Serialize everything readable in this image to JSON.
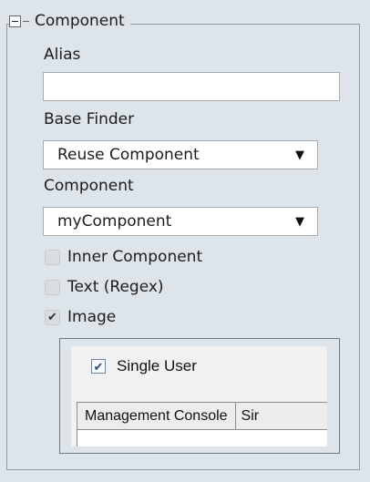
{
  "section": {
    "title": "Component"
  },
  "alias": {
    "label": "Alias",
    "value": ""
  },
  "base_finder": {
    "label": "Base Finder",
    "selected": "Reuse Component",
    "arrow": "▼"
  },
  "component": {
    "label": "Component",
    "selected": "myComponent",
    "arrow": "▼"
  },
  "options": [
    {
      "label": "Inner Component",
      "checked": false,
      "mark": ""
    },
    {
      "label": "Text (Regex)",
      "checked": false,
      "mark": ""
    },
    {
      "label": "Image",
      "checked": true,
      "mark": "✔"
    }
  ],
  "preview": {
    "checkbox_label": "Single User",
    "checkbox_checked": true,
    "check_mark": "✔",
    "tabs": [
      "Management Console",
      "Sir"
    ]
  }
}
